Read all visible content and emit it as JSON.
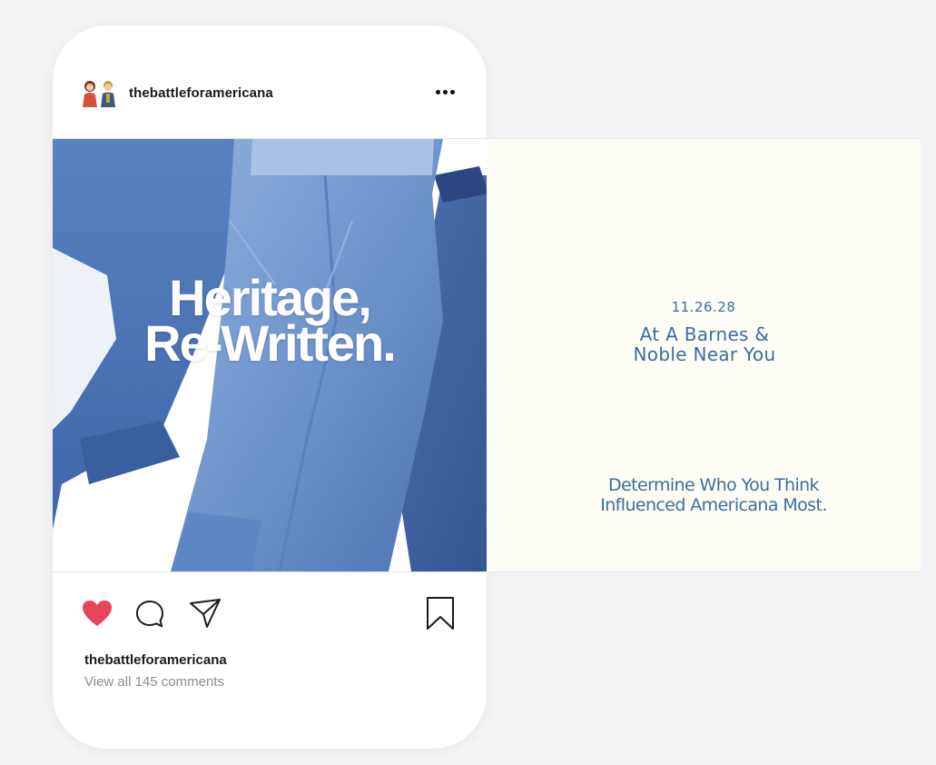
{
  "post": {
    "username": "thebattleforamericana",
    "menu_icon": "more-horizontal-icon",
    "slides": [
      {
        "headline_line1": "Heritage,",
        "headline_line2": "Re-Written."
      },
      {
        "date": "11.26.28",
        "location_line1": "At A Barnes &",
        "location_line2": "Noble Near You",
        "cta_line1": "Determine Who You Think",
        "cta_line2": "Influenced Americana Most."
      }
    ],
    "actions": {
      "like_icon": "heart-icon",
      "comment_icon": "comment-icon",
      "share_icon": "send-icon",
      "save_icon": "bookmark-icon",
      "liked": true
    },
    "caption_username": "thebattleforamericana",
    "comments_link": "View all 145 comments"
  },
  "colors": {
    "like_red": "#e8455a",
    "slide_text_blue": "#3d6d9e",
    "denim_dark": "#3a5f9e",
    "denim_light": "#6f95cc",
    "slide2_bg": "#fdfdf6"
  }
}
